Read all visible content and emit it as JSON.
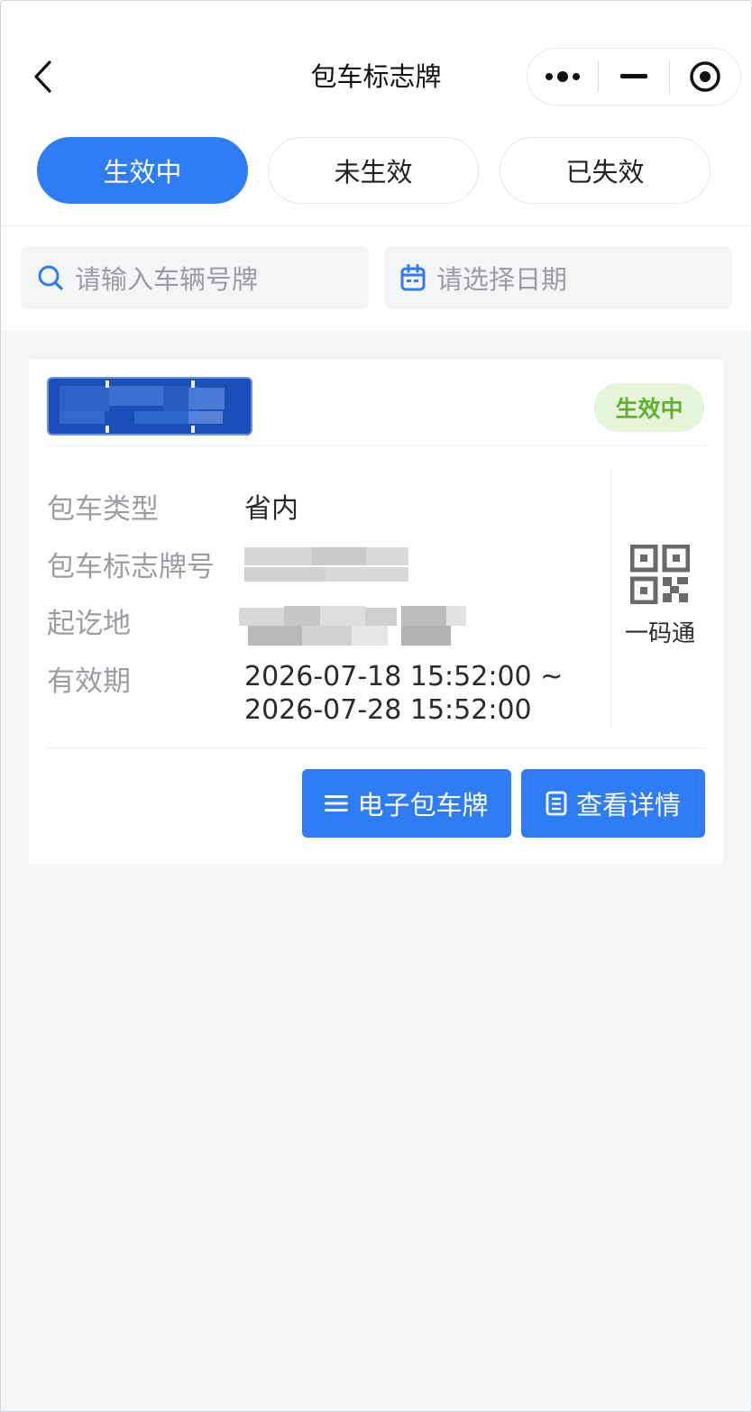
{
  "nav": {
    "title": "包车标志牌"
  },
  "tabs": [
    {
      "label": "生效中",
      "active": true
    },
    {
      "label": "未生效",
      "active": false
    },
    {
      "label": "已失效",
      "active": false
    }
  ],
  "search": {
    "plate_placeholder": "请输入车辆号牌",
    "date_placeholder": "请选择日期"
  },
  "card": {
    "status": "生效中",
    "rows": [
      {
        "label": "包车类型",
        "value": "省内"
      },
      {
        "label": "包车标志牌号",
        "value": ""
      },
      {
        "label": "起讫地",
        "value": ""
      },
      {
        "label": "有效期",
        "value_line1": "2026-07-18 15:52:00 ~",
        "value_line2": "2026-07-28 15:52:00"
      }
    ],
    "qr_label": "一码通",
    "buttons": {
      "electronic_plate": "电子包车牌",
      "view_details": "查看详情"
    }
  },
  "colors": {
    "accent": "#2f7df6",
    "status_green": "#62b032",
    "status_bg": "#e5f5d9",
    "page_bg": "#f4f5f7"
  },
  "icons": {
    "back": "chevron-left-icon",
    "more": "more-dots-icon",
    "minimize": "minus-icon",
    "close": "target-circle-icon",
    "search": "search-icon",
    "calendar": "calendar-icon",
    "qr": "qr-code-icon",
    "menu": "menu-lines-icon",
    "document": "document-icon"
  }
}
